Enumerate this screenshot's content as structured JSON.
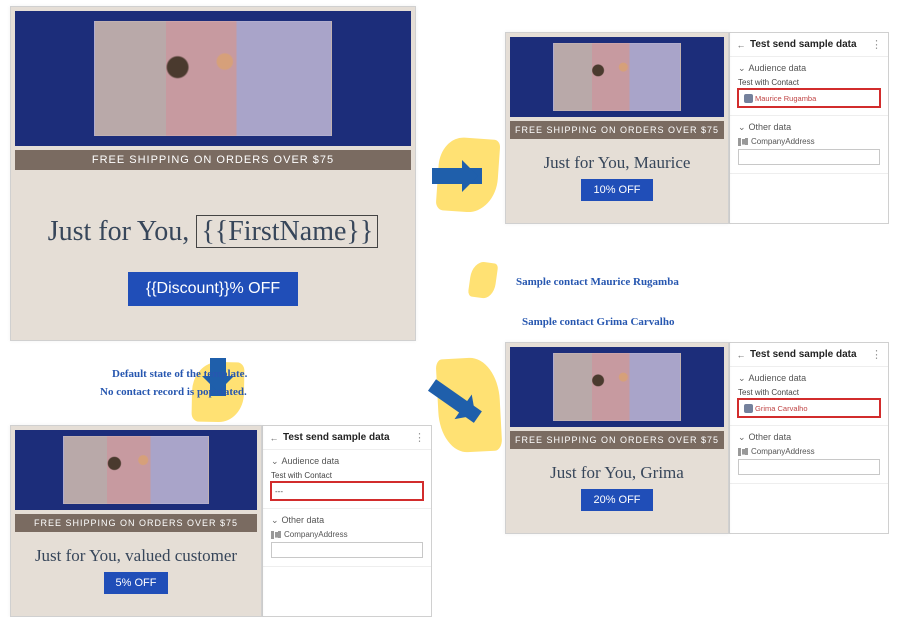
{
  "shipping_bar": "FREE SHIPPING ON ORDERS OVER $75",
  "template": {
    "greeting_text": "Just for You, ",
    "firstname_token": "{{FirstName}}",
    "cta_text": "{{Discount}}% OFF"
  },
  "scenarios": {
    "default": {
      "greeting": "Just for You, valued customer",
      "cta": "5% OFF",
      "contact_value": "---"
    },
    "maurice": {
      "greeting": "Just for You, Maurice",
      "cta": "10% OFF",
      "contact_value": "Maurice Rugamba"
    },
    "grima": {
      "greeting": "Just for You, Grima",
      "cta": "20% OFF",
      "contact_value": "Grima Carvalho"
    }
  },
  "panel": {
    "title": "Test send sample data",
    "section_audience": "Audience data",
    "field_contact_label": "Test with Contact",
    "section_other": "Other data",
    "field_company_label": "CompanyAddress"
  },
  "captions": {
    "default_1": "Default state of the template.",
    "default_2": "No contact record is populated.",
    "maurice": "Sample contact Maurice Rugamba",
    "grima": "Sample contact Grima Carvalho"
  }
}
